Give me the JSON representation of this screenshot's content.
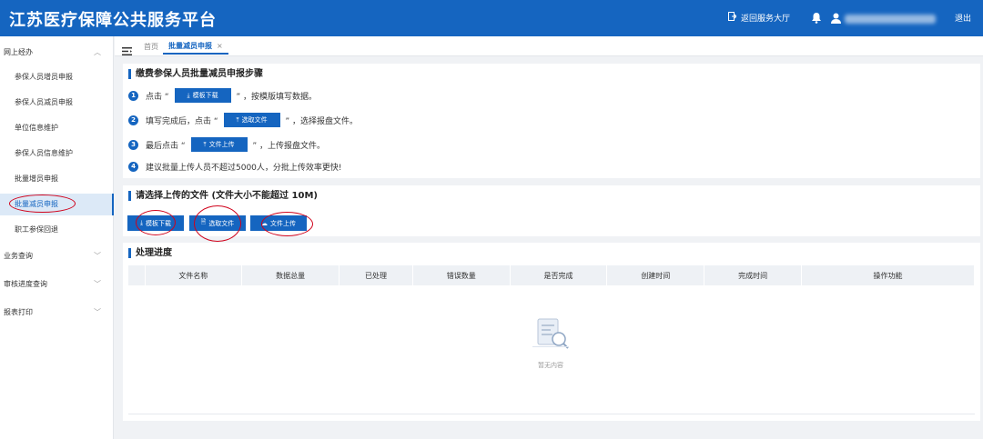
{
  "header": {
    "title": "江苏医疗保障公共服务平台",
    "return_label": "返回服务大厅",
    "logout_label": "退出",
    "icons": [
      "return-icon",
      "bell-icon",
      "user-icon"
    ]
  },
  "sidebar": {
    "groups": [
      {
        "label": "网上经办",
        "expanded": true
      },
      {
        "label": "业务查询",
        "expanded": false
      },
      {
        "label": "审核进度查询",
        "expanded": false
      },
      {
        "label": "报表打印",
        "expanded": false
      }
    ],
    "items": [
      {
        "label": "参保人员增员申报"
      },
      {
        "label": "参保人员减员申报"
      },
      {
        "label": "单位信息维护"
      },
      {
        "label": "参保人员信息维护"
      },
      {
        "label": "批量增员申报"
      },
      {
        "label": "批量减员申报",
        "active": true
      },
      {
        "label": "职工参保回退"
      }
    ]
  },
  "tabs": {
    "home": "首页",
    "active": "批量减员申报",
    "close": "×"
  },
  "steps_panel": {
    "title": "缴费参保人员批量减员申报步骤",
    "steps": [
      {
        "num": "1",
        "before": "点击 “",
        "button": "模板下载",
        "after": "” ，按模版填写数据。"
      },
      {
        "num": "2",
        "before": "填写完成后，点击 “",
        "button": "选取文件",
        "after": "” ，选择报盘文件。"
      },
      {
        "num": "3",
        "before": "最后点击 “",
        "button": "文件上传",
        "after": "” ，上传报盘文件。"
      },
      {
        "num": "4",
        "text": "建议批量上传人员不超过5000人，分批上传效率更快!"
      }
    ]
  },
  "upload_panel": {
    "title": "请选择上传的文件 (文件大小不能超过 10M)",
    "buttons": {
      "template": "模板下载",
      "select": "选取文件",
      "upload": "文件上传"
    }
  },
  "progress_panel": {
    "title": "处理进度",
    "columns": [
      "文件名称",
      "数据总量",
      "已处理",
      "错误数量",
      "是否完成",
      "创建时间",
      "完成时间",
      "操作功能"
    ],
    "empty_text": "暂无内容"
  },
  "colors": {
    "primary": "#1565c0",
    "annotation": "#d0021b",
    "active_bg": "#dce9f7"
  }
}
